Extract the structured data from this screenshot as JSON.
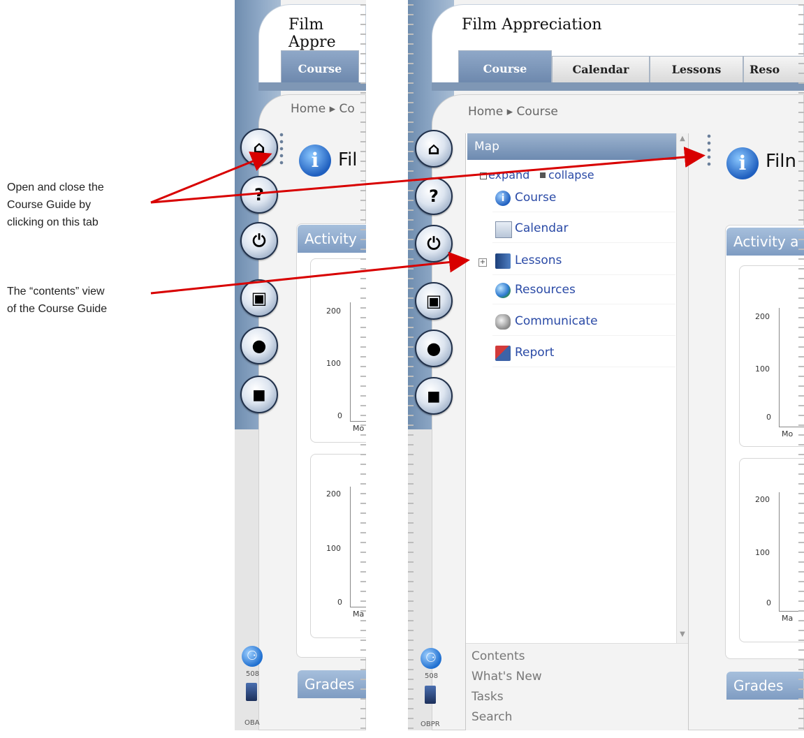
{
  "annotations": {
    "guide_tab_note": [
      "Open and close the",
      "Course Guide by",
      "clicking on this tab"
    ],
    "contents_view_note": [
      "The “contents” view",
      "of the Course Guide"
    ]
  },
  "app": {
    "title_left": "Film Appre",
    "title_right": "Film Appreciation",
    "breadcrumb_left": "Home ▸ Co",
    "breadcrumb_right": "Home ▸ Course",
    "course_heading_left": "Fil",
    "course_heading_right": "Filn"
  },
  "tabs": {
    "left": [
      "Course"
    ],
    "right": [
      "Course",
      "Calendar",
      "Lessons",
      "Reso"
    ]
  },
  "rail_buttons": [
    {
      "name": "home-icon",
      "glyph": "⌂"
    },
    {
      "name": "help-icon",
      "glyph": "?"
    },
    {
      "name": "power-icon",
      "glyph": "⏻"
    },
    {
      "name": "camera-icon",
      "glyph": "▣"
    },
    {
      "name": "person-icon",
      "glyph": "●"
    },
    {
      "name": "chat-icon",
      "glyph": "◼"
    }
  ],
  "rail_bottom": {
    "accessibility_caption": "508",
    "device_caption_left": "OBA",
    "device_caption_right": "OBPR"
  },
  "map": {
    "title": "Map",
    "expand": "expand",
    "collapse": "collapse",
    "items": [
      {
        "label": "Course",
        "icon": "info-icon"
      },
      {
        "label": "Calendar",
        "icon": "calendar-icon"
      },
      {
        "label": "Lessons",
        "icon": "book-icon"
      },
      {
        "label": "Resources",
        "icon": "globe-icon"
      },
      {
        "label": "Communicate",
        "icon": "communicate-icon"
      },
      {
        "label": "Report",
        "icon": "report-icon"
      }
    ]
  },
  "guide_tabs": [
    "Contents",
    "What's New",
    "Tasks",
    "Search"
  ],
  "panels": {
    "activity_left": "Activity",
    "activity_right": "Activity a",
    "grades": "Grades"
  },
  "chart_data": [
    {
      "type": "bar",
      "ylim": [
        0,
        200
      ],
      "yticks": [
        "200",
        "100",
        "0"
      ],
      "xtick_fragment": "Mo",
      "values": []
    },
    {
      "type": "bar",
      "ylim": [
        0,
        200
      ],
      "yticks": [
        "200",
        "100",
        "0"
      ],
      "xtick_fragment": "Ma",
      "values": []
    }
  ],
  "colors": {
    "annotation_arrow": "#d80000",
    "link": "#2a4aa6",
    "rail": "#7f97b5"
  }
}
